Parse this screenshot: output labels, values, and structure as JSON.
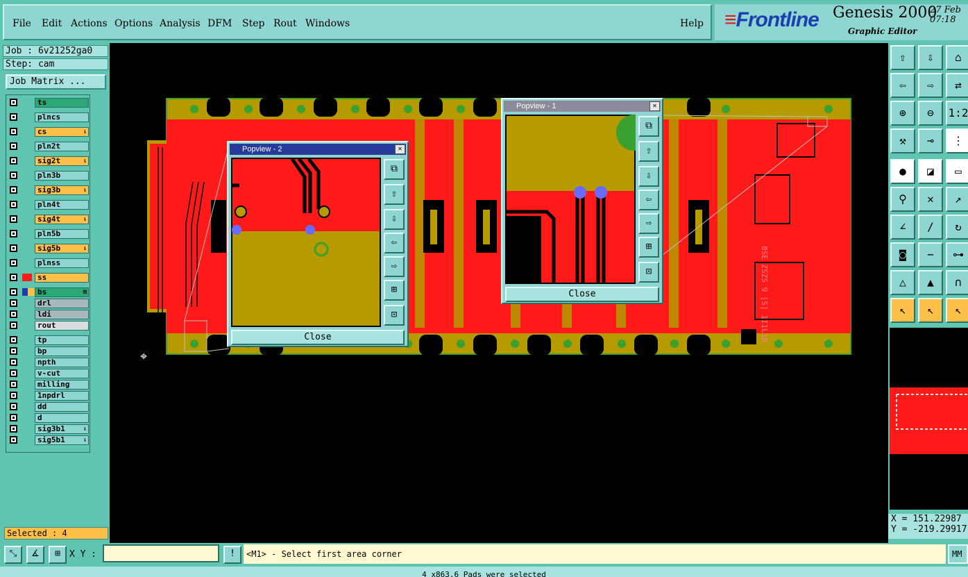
{
  "menu": {
    "items": [
      "File",
      "Edit",
      "Actions",
      "Options",
      "Analysis",
      "DFM",
      "Step",
      "Rout",
      "Windows"
    ],
    "help": "Help"
  },
  "brand": {
    "logo": "Frontline",
    "product": "Genesis 2000",
    "subtitle": "Graphic Editor",
    "date_line1": "27 Feb",
    "date_line2": "07:18"
  },
  "job": {
    "job_label": "Job : 6v21252ga0",
    "step_label": "Step: cam",
    "matrix_button": "Job Matrix ..."
  },
  "layers": [
    {
      "name": "ts",
      "style": "green",
      "sym": ""
    },
    {
      "name": "plncs",
      "style": "",
      "sym": ""
    },
    {
      "name": "cs",
      "style": "orange",
      "sym": "⇂"
    },
    {
      "name": "pln2t",
      "style": "",
      "sym": ""
    },
    {
      "name": "sig2t",
      "style": "orange",
      "sym": "⇂"
    },
    {
      "name": "pln3b",
      "style": "",
      "sym": ""
    },
    {
      "name": "sig3b",
      "style": "orange",
      "sym": "⇂"
    },
    {
      "name": "pln4t",
      "style": "",
      "sym": ""
    },
    {
      "name": "sig4t",
      "style": "orange",
      "sym": "⇂"
    },
    {
      "name": "pln5b",
      "style": "",
      "sym": ""
    },
    {
      "name": "sig5b",
      "style": "orange",
      "sym": "⇂"
    },
    {
      "name": "plnss",
      "style": "",
      "sym": ""
    },
    {
      "name": "ss",
      "style": "orange",
      "sym": ""
    },
    {
      "name": "bs",
      "style": "green",
      "sym": "⊞"
    }
  ],
  "layers2": [
    {
      "name": "drl",
      "style": "grey",
      "sym": ""
    },
    {
      "name": "ldi",
      "style": "grey",
      "sym": ""
    },
    {
      "name": "rout",
      "style": "ltgrey",
      "sym": ""
    }
  ],
  "layers3": [
    {
      "name": "tp",
      "style": "",
      "sym": ""
    },
    {
      "name": "bp",
      "style": "",
      "sym": ""
    },
    {
      "name": "npth",
      "style": "",
      "sym": ""
    },
    {
      "name": "v-cut",
      "style": "",
      "sym": ""
    },
    {
      "name": "milling",
      "style": "",
      "sym": ""
    },
    {
      "name": "1npdrl",
      "style": "",
      "sym": ""
    },
    {
      "name": "dd",
      "style": "",
      "sym": ""
    },
    {
      "name": "d",
      "style": "",
      "sym": ""
    },
    {
      "name": "sig3b1",
      "style": "",
      "sym": "⇂"
    },
    {
      "name": "sig5b1",
      "style": "",
      "sym": "⇂"
    }
  ],
  "selected": "Selected : 4",
  "popview1": {
    "title": "Popview - 1",
    "close": "Close"
  },
  "popview2": {
    "title": "Popview - 2",
    "close": "Close"
  },
  "pcb_text": "8SE ZSZS 9 [S] 1I1L1B",
  "coords": {
    "x": "X = 151.22987",
    "y": "Y = -219.29917"
  },
  "bottom": {
    "xy_label": "X Y :",
    "xy_value": "",
    "prompt": "<M1> - Select first area corner",
    "units": "MM",
    "status": "4 x863.6 Pads were selected"
  },
  "colors": {
    "board": "#ff1a1a",
    "copper": "#b59a00",
    "background": "#000000",
    "panel": "#5fc4b0"
  }
}
